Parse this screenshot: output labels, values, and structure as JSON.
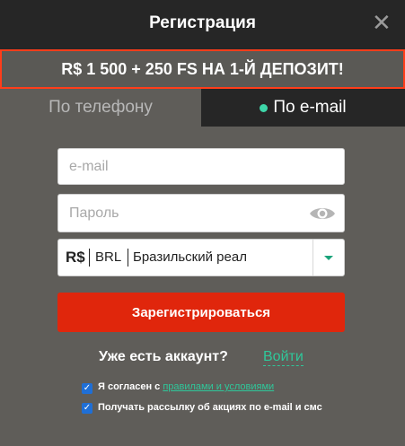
{
  "header": {
    "title": "Регистрация",
    "close_icon": "close-icon"
  },
  "promo": {
    "text": "R$ 1 500 + 250 FS НА 1-Й ДЕПОЗИТ!",
    "border_color": "#ff3d1a"
  },
  "tabs": [
    {
      "label": "По телефону",
      "active": false
    },
    {
      "label": "По e-mail",
      "active": true
    }
  ],
  "form": {
    "email_placeholder": "e-mail",
    "email_value": "",
    "password_placeholder": "Пароль",
    "password_value": "",
    "eye_icon": "eye-icon",
    "currency": {
      "symbol": "R$",
      "code": "BRL",
      "name": "Бразильский реал"
    },
    "submit_label": "Зарегистрироваться"
  },
  "login": {
    "question": "Уже есть аккаунт?",
    "link": "Войти"
  },
  "consents": {
    "agree_prefix": "Я согласен с",
    "agree_link": "правилами и условиями",
    "agree_checked": true,
    "newsletter": "Получать рассылку об акциях по e-mail и смс",
    "newsletter_checked": true
  },
  "colors": {
    "accent_green": "#2fc79a",
    "button_red": "#e0260c",
    "dark": "#262626",
    "panel": "#5f5d59"
  }
}
